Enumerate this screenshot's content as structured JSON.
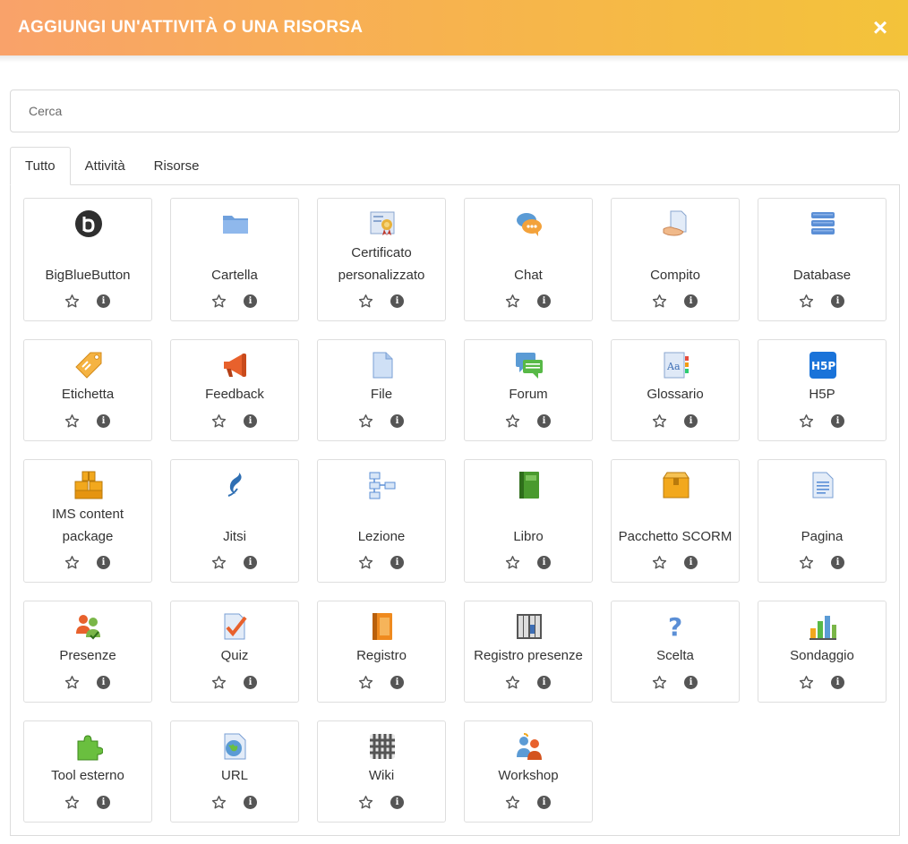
{
  "modal": {
    "title": "AGGIUNGI UN'ATTIVITÀ O UNA RISORSA",
    "close_label": "×"
  },
  "search": {
    "placeholder": "Cerca",
    "value": ""
  },
  "tabs": [
    {
      "label": "Tutto",
      "active": true
    },
    {
      "label": "Attività",
      "active": false
    },
    {
      "label": "Risorse",
      "active": false
    }
  ],
  "items": [
    {
      "name": "BigBlueButton",
      "icon": "bigbluebutton-icon"
    },
    {
      "name": "Cartella",
      "icon": "folder-icon"
    },
    {
      "name": "Certificato personalizzato",
      "icon": "certificate-icon"
    },
    {
      "name": "Chat",
      "icon": "chat-icon"
    },
    {
      "name": "Compito",
      "icon": "assignment-icon"
    },
    {
      "name": "Database",
      "icon": "database-icon"
    },
    {
      "name": "Etichetta",
      "icon": "label-icon"
    },
    {
      "name": "Feedback",
      "icon": "megaphone-icon"
    },
    {
      "name": "File",
      "icon": "file-icon"
    },
    {
      "name": "Forum",
      "icon": "forum-icon"
    },
    {
      "name": "Glossario",
      "icon": "glossary-icon"
    },
    {
      "name": "H5P",
      "icon": "h5p-icon"
    },
    {
      "name": "IMS content package",
      "icon": "ims-package-icon"
    },
    {
      "name": "Jitsi",
      "icon": "jitsi-icon"
    },
    {
      "name": "Lezione",
      "icon": "lesson-icon"
    },
    {
      "name": "Libro",
      "icon": "book-icon"
    },
    {
      "name": "Pacchetto SCORM",
      "icon": "scorm-package-icon"
    },
    {
      "name": "Pagina",
      "icon": "page-icon"
    },
    {
      "name": "Presenze",
      "icon": "attendance-icon"
    },
    {
      "name": "Quiz",
      "icon": "quiz-icon"
    },
    {
      "name": "Registro",
      "icon": "register-icon"
    },
    {
      "name": "Registro presenze",
      "icon": "attendance-register-icon"
    },
    {
      "name": "Scelta",
      "icon": "choice-icon"
    },
    {
      "name": "Sondaggio",
      "icon": "survey-icon"
    },
    {
      "name": "Tool esterno",
      "icon": "external-tool-icon"
    },
    {
      "name": "URL",
      "icon": "url-icon"
    },
    {
      "name": "Wiki",
      "icon": "wiki-icon"
    },
    {
      "name": "Workshop",
      "icon": "workshop-icon"
    }
  ],
  "colors": {
    "header_gradient_start": "#f9a26a",
    "header_gradient_end": "#f3c33a"
  }
}
